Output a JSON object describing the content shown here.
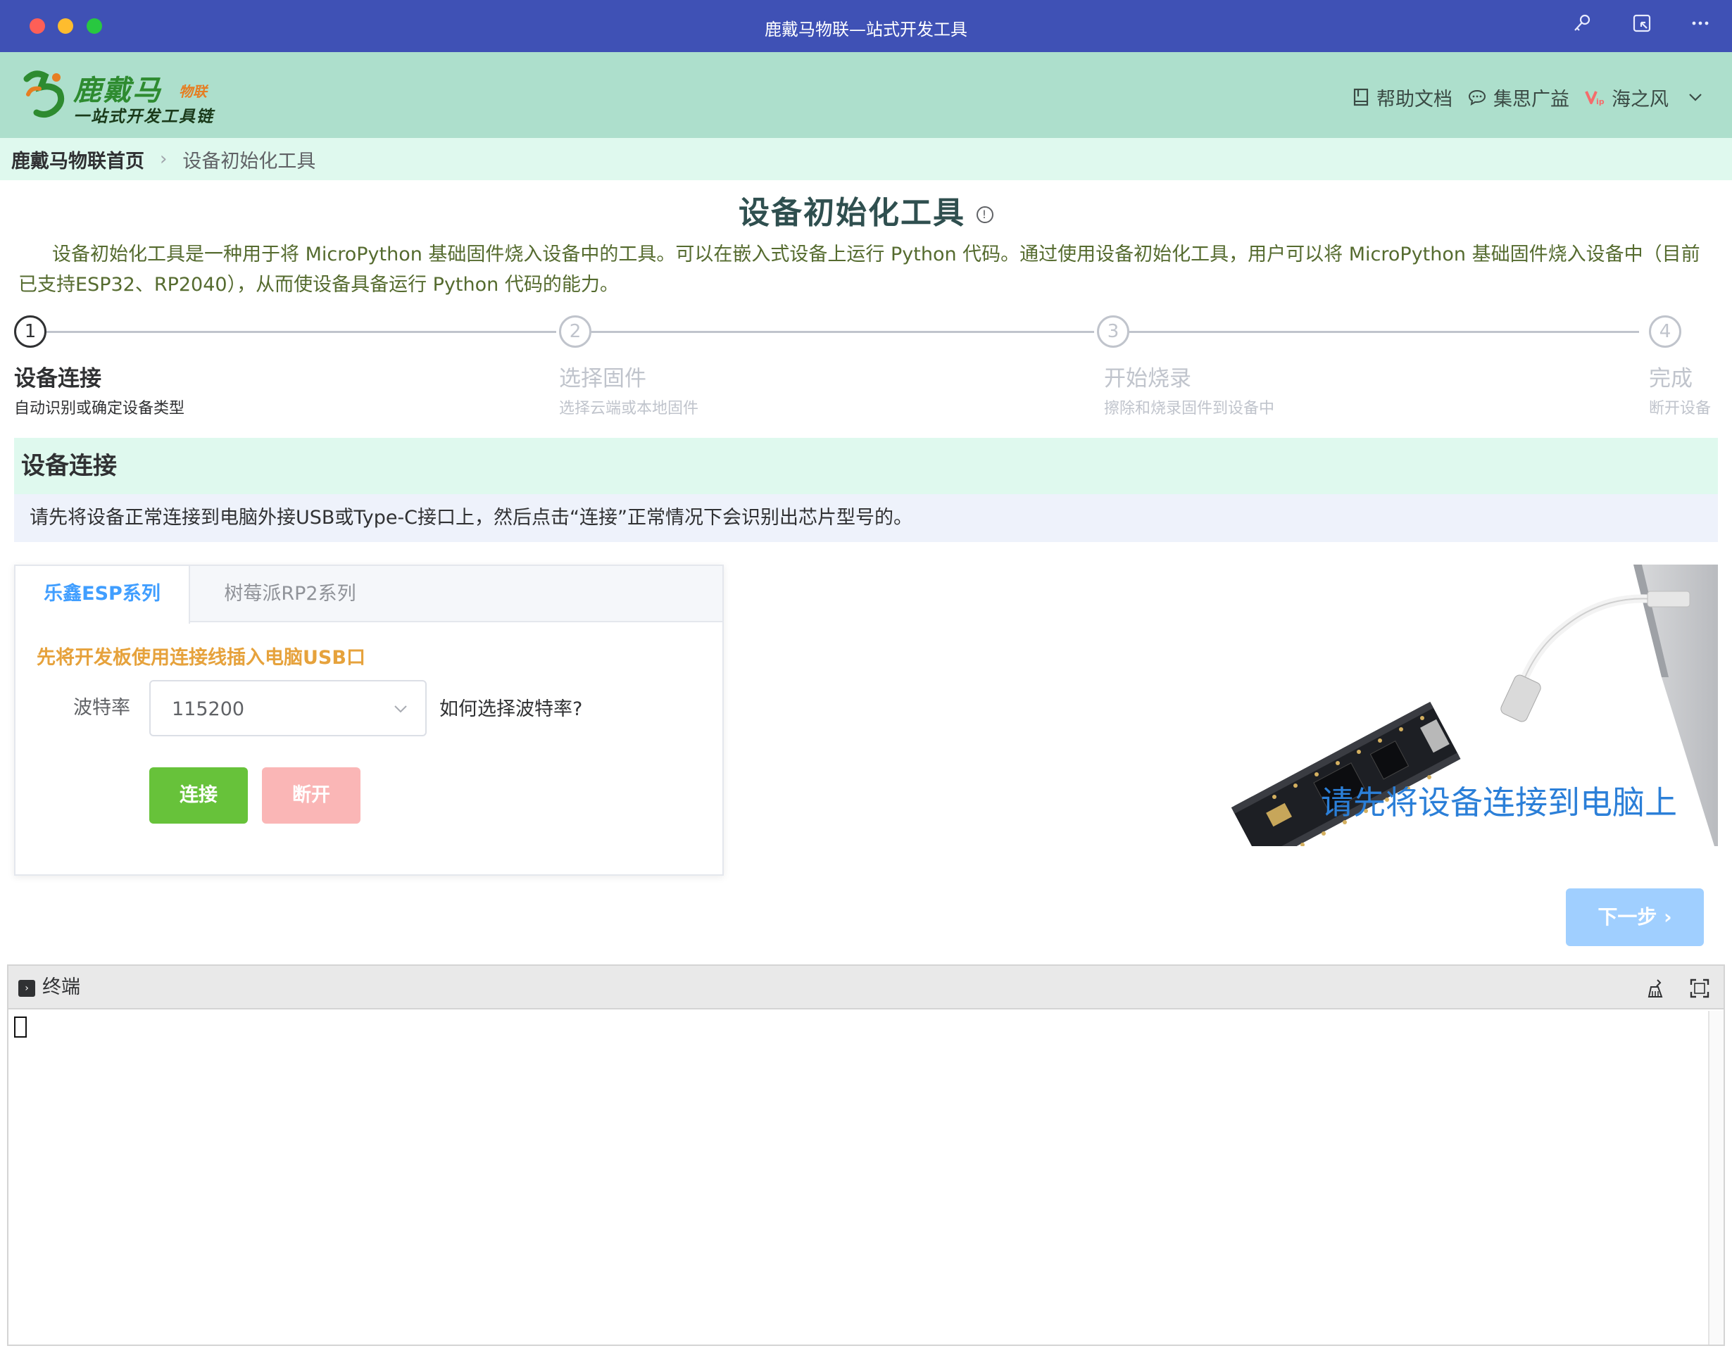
{
  "window": {
    "title": "鹿戴马物联—站式开发工具"
  },
  "header": {
    "logo_name": "鹿戴马",
    "logo_sub": "物联",
    "logo_tagline": "一站式开发工具链",
    "links": [
      {
        "label": "帮助文档",
        "icon": "book-icon"
      },
      {
        "label": "集思广益",
        "icon": "chat-icon"
      },
      {
        "label": "海之风",
        "icon": "vip-icon"
      }
    ]
  },
  "breadcrumb": {
    "home": "鹿戴马物联首页",
    "current": "设备初始化工具"
  },
  "page": {
    "title": "设备初始化工具",
    "info_glyph": "!",
    "intro": "设备初始化工具是一种用于将 MicroPython 基础固件烧入设备中的工具。可以在嵌入式设备上运行 Python 代码。通过使用设备初始化工具，用户可以将 MicroPython 基础固件烧入设备中（目前已支持ESP32、RP2040），从而使设备具备运行 Python 代码的能力。"
  },
  "steps": [
    {
      "number": "1",
      "title": "设备连接",
      "desc": "自动识别或确定设备类型",
      "active": true
    },
    {
      "number": "2",
      "title": "选择固件",
      "desc": "选择云端或本地固件",
      "active": false
    },
    {
      "number": "3",
      "title": "开始烧录",
      "desc": "擦除和烧录固件到设备中",
      "active": false
    },
    {
      "number": "4",
      "title": "完成",
      "desc": "断开设备",
      "active": false
    }
  ],
  "section": {
    "title": "设备连接",
    "note": "请先将设备正常连接到电脑外接USB或Type-C接口上，然后点击“连接”正常情况下会识别出芯片型号的。"
  },
  "card": {
    "tabs": [
      {
        "label": "乐鑫ESP系列",
        "active": true
      },
      {
        "label": "树莓派RP2系列",
        "active": false
      }
    ],
    "hint": "先将开发板使用连接线插入电脑USB口",
    "baud_label": "波特率",
    "baud_value": "115200",
    "baud_help": "如何选择波特率?",
    "connect_label": "连接",
    "disconnect_label": "断开"
  },
  "illustration": {
    "caption": "请先将设备连接到电脑上"
  },
  "next_button": "下一步 ›",
  "terminal": {
    "title": "终端",
    "icon_glyph": "›"
  },
  "colors": {
    "titlebar": "#3f51b5",
    "header": "#addfcc",
    "breadcrumb_bg": "#dff9ee",
    "primary": "#409eff",
    "success": "#67c23a",
    "danger_light": "#fab6b6",
    "warning": "#e6a23c"
  }
}
